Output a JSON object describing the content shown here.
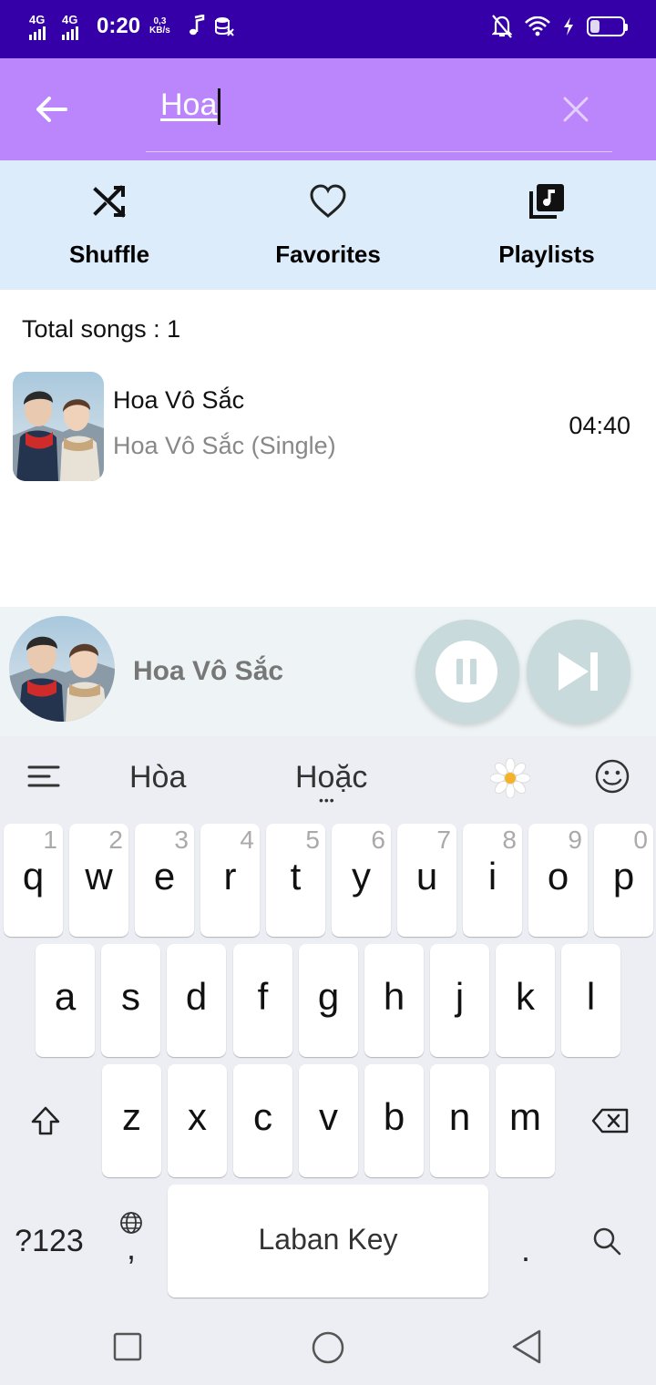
{
  "status_bar": {
    "network_1": "4G",
    "network_2": "4G",
    "time": "0:20",
    "speed_value": "0,3",
    "speed_unit": "KB/s",
    "battery_level": "26",
    "icons": [
      "music-note-icon",
      "data-icon",
      "mute-notification-icon",
      "wifi-icon",
      "charging-icon",
      "battery-icon"
    ]
  },
  "search": {
    "query": "Hoa",
    "back_icon": "arrow-left-icon",
    "clear_icon": "close-icon"
  },
  "actions": [
    {
      "label": "Shuffle",
      "icon": "shuffle-icon"
    },
    {
      "label": "Favorites",
      "icon": "heart-icon"
    },
    {
      "label": "Playlists",
      "icon": "playlist-icon"
    }
  ],
  "list": {
    "total_label": "Total songs : 1",
    "songs": [
      {
        "title": "Hoa Vô Sắc",
        "album": "Hoa Vô Sắc (Single)",
        "duration": "04:40"
      }
    ]
  },
  "player": {
    "title": "Hoa Vô Sắc",
    "pause_icon": "pause-icon",
    "next_icon": "skip-next-icon"
  },
  "keyboard": {
    "suggestions": [
      "Hòa",
      "Hoặc"
    ],
    "more_indicator": "•••",
    "row1": [
      {
        "ch": "q",
        "num": "1"
      },
      {
        "ch": "w",
        "num": "2"
      },
      {
        "ch": "e",
        "num": "3"
      },
      {
        "ch": "r",
        "num": "4"
      },
      {
        "ch": "t",
        "num": "5"
      },
      {
        "ch": "y",
        "num": "6"
      },
      {
        "ch": "u",
        "num": "7"
      },
      {
        "ch": "i",
        "num": "8"
      },
      {
        "ch": "o",
        "num": "9"
      },
      {
        "ch": "p",
        "num": "0"
      }
    ],
    "row2": [
      "a",
      "s",
      "d",
      "f",
      "g",
      "h",
      "j",
      "k",
      "l"
    ],
    "row3": [
      "z",
      "x",
      "c",
      "v",
      "b",
      "n",
      "m"
    ],
    "symbols_label": "?123",
    "comma_label": ",",
    "space_label": "Laban Key",
    "period_label": "."
  },
  "colors": {
    "status_bar": "#3600a8",
    "search_bar": "#bb86fc",
    "action_bar": "#dcecfb",
    "player_bg": "#eef4f5",
    "keyboard_bg": "#eceef3"
  }
}
